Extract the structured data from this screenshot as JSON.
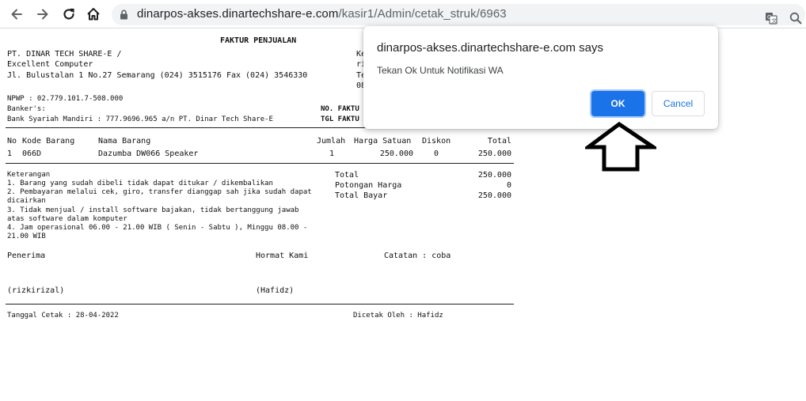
{
  "browser": {
    "url_host": "dinarpos-akses.dinartechshare-e.com",
    "url_path": "/kasir1/Admin/cetak_struk/6963"
  },
  "invoice": {
    "title": "FAKTUR PENJUALAN",
    "company_line1": "PT. DINAR TECH SHARE-E /",
    "company_line2": "Excellent Computer",
    "address": "Jl. Bulustalan 1 No.27 Semarang (024) 3515176 Fax (024) 3546330",
    "right_col_1": "Ke",
    "right_col_2": "ri",
    "right_col_3": "Te",
    "right_col_4": "08",
    "npwp": "NPWP : 02.779.101.7-508.000",
    "bankers": "Banker's:",
    "bank": "Bank Syariah Mandiri : 777.9696.965 a/n PT. Dinar Tech Share-E",
    "no_faktur_label": "NO. FAKTU",
    "tgl_faktur_label": "TGL FAKTU",
    "columns": {
      "no": "No",
      "kode": "Kode Barang",
      "nama": "Nama Barang",
      "jumlah": "Jumlah",
      "harga": "Harga Satuan",
      "diskon": "Diskon",
      "total": "Total"
    },
    "items": [
      {
        "no": "1",
        "kode": "066D",
        "nama": "Dazumba DW066 Speaker",
        "jumlah": "1",
        "harga": "250.000",
        "diskon": "0",
        "total": "250.000"
      }
    ],
    "keterangan_title": "Keterangan",
    "notes": [
      "1. Barang yang sudah dibeli tidak dapat ditukar / dikembalikan",
      "2. Pembayaran melalui cek, giro, transfer dianggap sah jika sudah dapat",
      "dicairkan",
      "3. Tidak menjual / install software bajakan, tidak bertanggung jawab",
      "atas software dalam komputer",
      "4. Jam operasional 06.00 - 21.00 WIB ( Senin - Sabtu ), Minggu 08.00 -",
      "21.00 WIB"
    ],
    "summary": {
      "total_label": "Total",
      "total_value": "250.000",
      "potongan_label": "Potongan Harga",
      "potongan_value": "0",
      "bayar_label": "Total Bayar",
      "bayar_value": "250.000"
    },
    "penerima_label": "Penerima",
    "hormat_label": "Hormat Kami",
    "catatan": "Catatan : coba",
    "penerima_name": "(rizkirizal)",
    "hormat_name": "(Hafidz)",
    "tanggal_cetak": "Tanggal Cetak : 28-04-2022",
    "dicetak_oleh": "Dicetak Oleh : Hafidz"
  },
  "dialog": {
    "title": "dinarpos-akses.dinartechshare-e.com says",
    "message": "Tekan Ok Untuk Notifikasi WA",
    "ok_label": "OK",
    "cancel_label": "Cancel"
  },
  "colors": {
    "accent": "#1a73e8",
    "toolbar_bg": "#ffffff",
    "omnibox_bg": "#f1f3f4"
  },
  "icons": [
    "back-arrow-icon",
    "forward-arrow-icon",
    "reload-icon",
    "home-icon",
    "lock-icon",
    "translate-icon",
    "zoom-icon",
    "up-arrow-annotation-icon"
  ]
}
